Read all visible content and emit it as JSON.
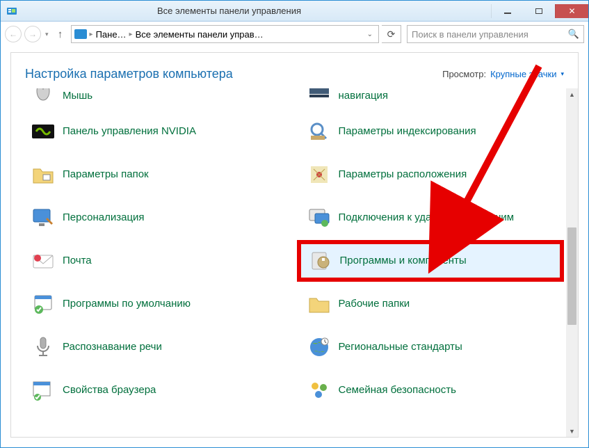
{
  "titlebar": {
    "title": "Все элементы панели управления"
  },
  "nav": {
    "crumb1": "Пане…",
    "crumb2": "Все элементы панели управ…"
  },
  "search": {
    "placeholder": "Поиск в панели управления"
  },
  "header": {
    "title": "Настройка параметров компьютера",
    "view_label": "Просмотр:",
    "view_value": "Крупные значки"
  },
  "items": {
    "left": [
      {
        "name": "mouse",
        "label": "Мышь"
      },
      {
        "name": "nvidia",
        "label": "Панель управления NVIDIA"
      },
      {
        "name": "folder-options",
        "label": "Параметры папок"
      },
      {
        "name": "personalization",
        "label": "Персонализация"
      },
      {
        "name": "mail",
        "label": "Почта"
      },
      {
        "name": "default-programs",
        "label": "Программы по умолчанию"
      },
      {
        "name": "speech",
        "label": "Распознавание речи"
      },
      {
        "name": "browser-props",
        "label": "Свойства браузера"
      }
    ],
    "right": [
      {
        "name": "navigation",
        "label": "навигация"
      },
      {
        "name": "indexing",
        "label": "Параметры индексирования"
      },
      {
        "name": "location",
        "label": "Параметры расположения"
      },
      {
        "name": "rdp",
        "label": "Подключения к удаленным рабочим"
      },
      {
        "name": "programs-features",
        "label": "Программы и компоненты",
        "highlight": true
      },
      {
        "name": "work-folders",
        "label": "Рабочие папки"
      },
      {
        "name": "region",
        "label": "Региональные стандарты"
      },
      {
        "name": "family-safety",
        "label": "Семейная безопасность"
      }
    ]
  }
}
